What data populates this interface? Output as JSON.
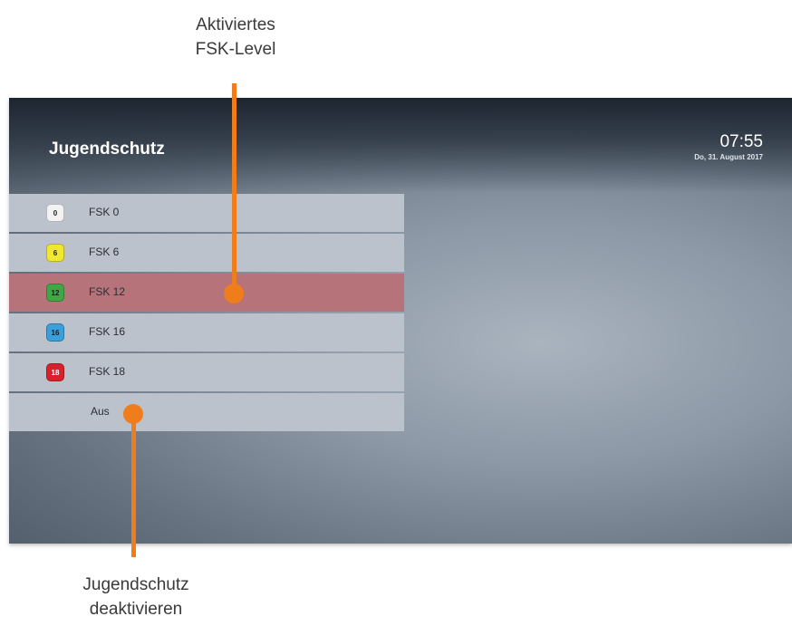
{
  "annotations": {
    "top": {
      "line1": "Aktiviertes",
      "line2": "FSK-Level"
    },
    "bottom": {
      "line1": "Jugendschutz",
      "line2": "deaktivieren"
    },
    "accent": "#ef7d1c"
  },
  "screen": {
    "title": "Jugendschutz",
    "time": "07:55",
    "date": "Do, 31. August 2017"
  },
  "menu": {
    "items": [
      {
        "label": "FSK 0",
        "badge": "0",
        "badge_color": "#f2f2f2"
      },
      {
        "label": "FSK 6",
        "badge": "6",
        "badge_color": "#f0e830"
      },
      {
        "label": "FSK 12",
        "badge": "12",
        "badge_color": "#3fa845",
        "selected": true
      },
      {
        "label": "FSK 16",
        "badge": "16",
        "badge_color": "#3aa0dd"
      },
      {
        "label": "FSK 18",
        "badge": "18",
        "badge_color": "#d8222b"
      },
      {
        "label": "Aus"
      }
    ]
  }
}
